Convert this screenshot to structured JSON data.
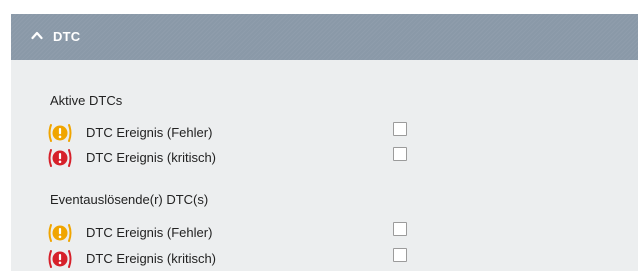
{
  "panel": {
    "title": "DTC",
    "expanded": true,
    "colors": {
      "header_bg": "#8a99a8",
      "body_bg": "#eceeef",
      "warning": "#f0a500",
      "critical": "#d6202a"
    }
  },
  "sections": [
    {
      "label": "Aktive DTCs",
      "rows": [
        {
          "label": "DTC Ereignis (Fehler)",
          "icon": "warning-icon",
          "checked": false
        },
        {
          "label": "DTC Ereignis (kritisch)",
          "icon": "critical-icon",
          "checked": false
        }
      ]
    },
    {
      "label": "Eventauslösende(r) DTC(s)",
      "rows": [
        {
          "label": "DTC Ereignis (Fehler)",
          "icon": "warning-icon",
          "checked": false
        },
        {
          "label": "DTC Ereignis (kritisch)",
          "icon": "critical-icon",
          "checked": false
        }
      ]
    }
  ]
}
